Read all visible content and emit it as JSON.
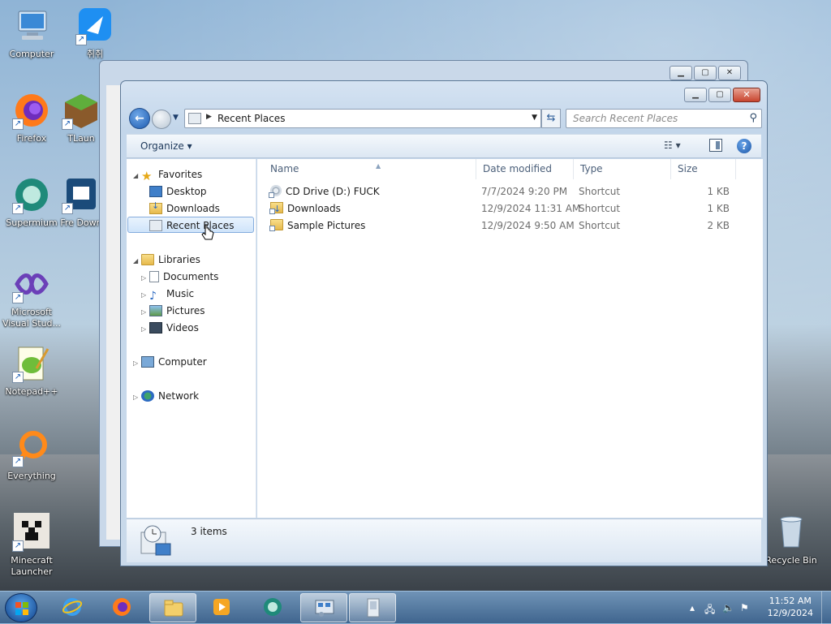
{
  "desktop": {
    "icons": [
      {
        "label": "Computer"
      },
      {
        "label": "취취"
      },
      {
        "label": "Firefox"
      },
      {
        "label": "TLaun"
      },
      {
        "label": "Supermium"
      },
      {
        "label": "Fre Down"
      },
      {
        "label": "Microsoft Visual Stud..."
      },
      {
        "label": "Notepad++"
      },
      {
        "label": "Everything"
      },
      {
        "label": "Minecraft Launcher"
      },
      {
        "label": "Recycle Bin"
      }
    ]
  },
  "explorer": {
    "address": {
      "path": "Recent Places"
    },
    "search": {
      "placeholder": "Search Recent Places"
    },
    "command_bar": {
      "organize": "Organize"
    },
    "nav": {
      "favorites": "Favorites",
      "desktop": "Desktop",
      "downloads": "Downloads",
      "recent_places": "Recent Places",
      "libraries": "Libraries",
      "documents": "Documents",
      "music": "Music",
      "pictures": "Pictures",
      "videos": "Videos",
      "computer": "Computer",
      "network": "Network"
    },
    "columns": {
      "name": "Name",
      "date": "Date modified",
      "type": "Type",
      "size": "Size"
    },
    "files": [
      {
        "name": "CD Drive (D:) FUCK",
        "date": "7/7/2024 9:20 PM",
        "type": "Shortcut",
        "size": "1 KB",
        "icon": "cd-drive-icon"
      },
      {
        "name": "Downloads",
        "date": "12/9/2024 11:31 AM",
        "type": "Shortcut",
        "size": "1 KB",
        "icon": "downloads-folder-icon"
      },
      {
        "name": "Sample Pictures",
        "date": "12/9/2024 9:50 AM",
        "type": "Shortcut",
        "size": "2 KB",
        "icon": "folder-icon"
      }
    ],
    "details": {
      "count": "3 items"
    }
  },
  "taskbar": {
    "clock": {
      "time": "11:52 AM",
      "date": "12/9/2024"
    }
  }
}
